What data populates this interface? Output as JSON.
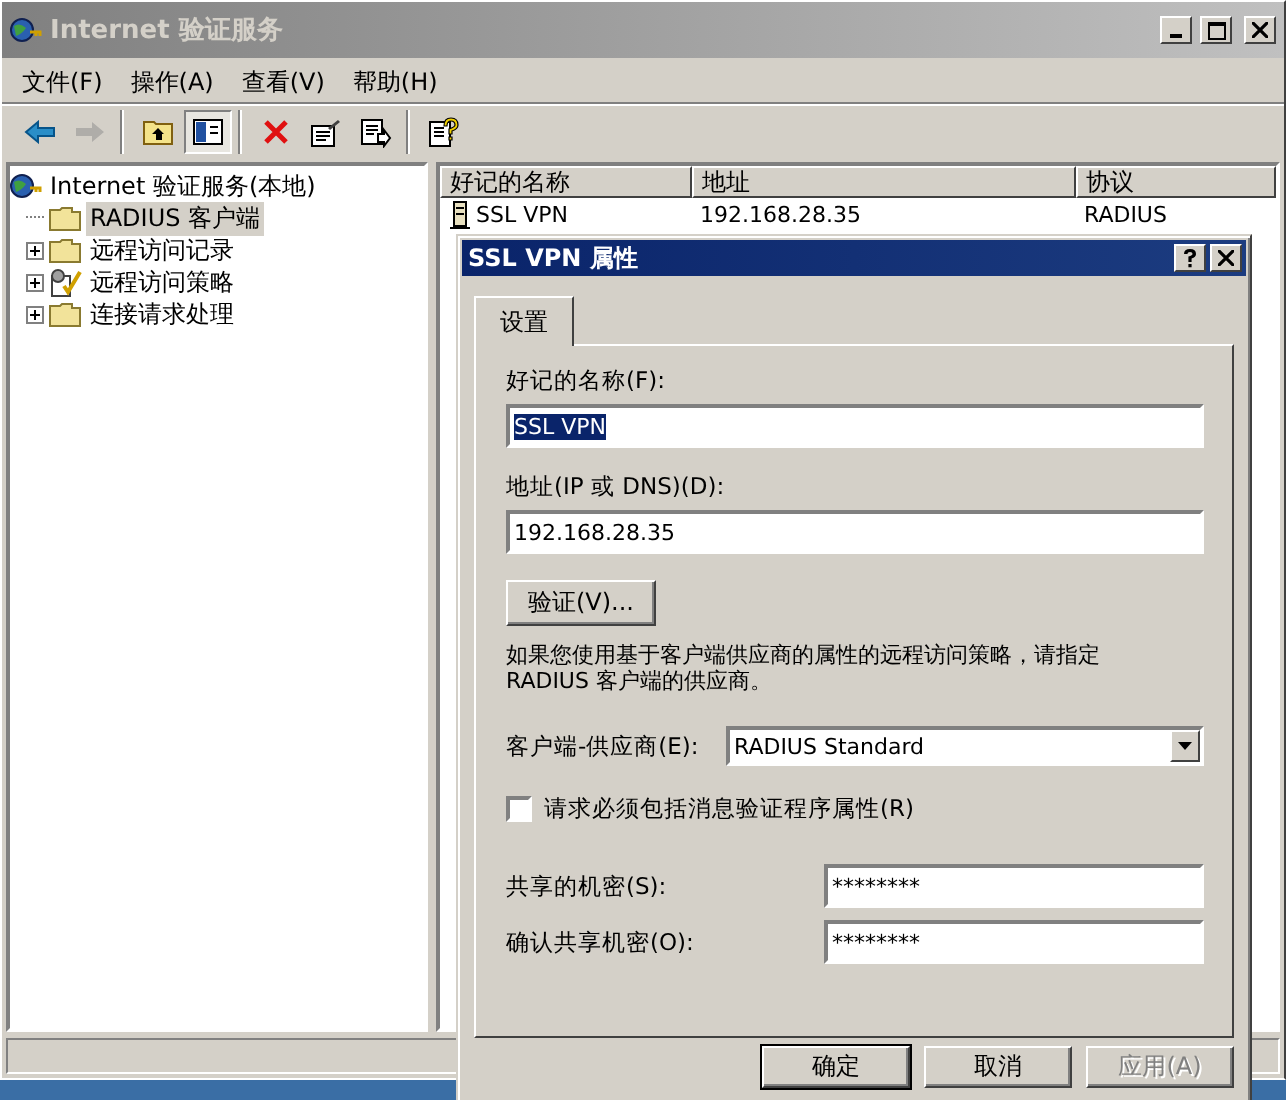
{
  "window": {
    "title": "Internet 验证服务"
  },
  "menu": [
    "文件(F)",
    "操作(A)",
    "查看(V)",
    "帮助(H)"
  ],
  "toolbar": [
    [
      {
        "kind": "back",
        "disabled": false,
        "pressed": false
      },
      {
        "kind": "forward",
        "disabled": true,
        "pressed": false
      }
    ],
    [
      {
        "kind": "up",
        "disabled": false,
        "pressed": false
      },
      {
        "kind": "tree",
        "disabled": false,
        "pressed": true
      }
    ],
    [
      {
        "kind": "delete",
        "disabled": false,
        "pressed": false
      },
      {
        "kind": "properties",
        "disabled": false,
        "pressed": false
      },
      {
        "kind": "export",
        "disabled": false,
        "pressed": false
      }
    ],
    [
      {
        "kind": "help",
        "disabled": false,
        "pressed": false
      }
    ]
  ],
  "tree": {
    "label": "Internet 验证服务(本地)",
    "selected": false,
    "children": [
      {
        "label": "RADIUS 客户端",
        "kind": "folder",
        "selected": true,
        "expandable": false
      },
      {
        "label": "远程访问记录",
        "kind": "folder",
        "selected": false,
        "expandable": true
      },
      {
        "label": "远程访问策略",
        "kind": "policy",
        "selected": false,
        "expandable": true
      },
      {
        "label": "连接请求处理",
        "kind": "folder",
        "selected": false,
        "expandable": true
      }
    ]
  },
  "list": {
    "columns": [
      "好记的名称",
      "地址",
      "协议"
    ],
    "rows": [
      {
        "cells": [
          "SSL VPN",
          "192.168.28.35",
          "RADIUS"
        ],
        "selected": false
      }
    ]
  },
  "dialog": {
    "title": "SSL VPN 属性",
    "tabs": [
      {
        "label": "设置",
        "selected": true
      }
    ],
    "name_label": "好记的名称(F):",
    "name_value": "SSL VPN",
    "name_highlighted": true,
    "address_label": "地址(IP 或 DNS)(D):",
    "address_value": "192.168.28.35",
    "verify_button": "验证(V)...",
    "note": "如果您使用基于客户端供应商的属性的远程访问策略，请指定 RADIUS 客户端的供应商。",
    "vendor_label": "客户端-供应商(E):",
    "vendor_value": "RADIUS Standard",
    "checkbox": {
      "label": "请求必须包括消息验证程序属性(R)",
      "checked": false
    },
    "secret_label": "共享的机密(S):",
    "secret_value": "********",
    "confirm_label": "确认共享机密(O):",
    "confirm_value": "********",
    "buttons": [
      {
        "label": "确定",
        "disabled": false,
        "default": true
      },
      {
        "label": "取消",
        "disabled": false,
        "default": false
      },
      {
        "label": "应用(A)",
        "disabled": true,
        "default": false
      }
    ]
  }
}
